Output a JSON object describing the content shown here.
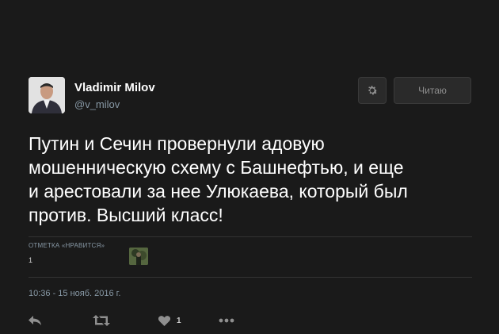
{
  "author": {
    "name": "Vladimir Milov",
    "handle": "@v_milov"
  },
  "header": {
    "follow_label": "Читаю",
    "settings_icon": "gear-icon"
  },
  "tweet": {
    "lines": [
      "Путин и Сечин провернули адовую",
      "мошенническую схему с Башнефтью, и еще",
      "и арестовали за нее Улюкаева, который был",
      "против. Высший класс!"
    ]
  },
  "stats": {
    "likes_label": "ОТМЕТКА «НРАВИТСЯ»",
    "likes_count": "1"
  },
  "timestamp": "10:36 - 15 нояб. 2016 г.",
  "actions": {
    "reply_icon": "reply-icon",
    "retweet_icon": "retweet-icon",
    "like_icon": "heart-icon",
    "like_count": "1",
    "more_icon": "more-icon"
  },
  "colors": {
    "background": "#1a1a1a",
    "text": "#ffffff",
    "muted": "#8899a6"
  }
}
